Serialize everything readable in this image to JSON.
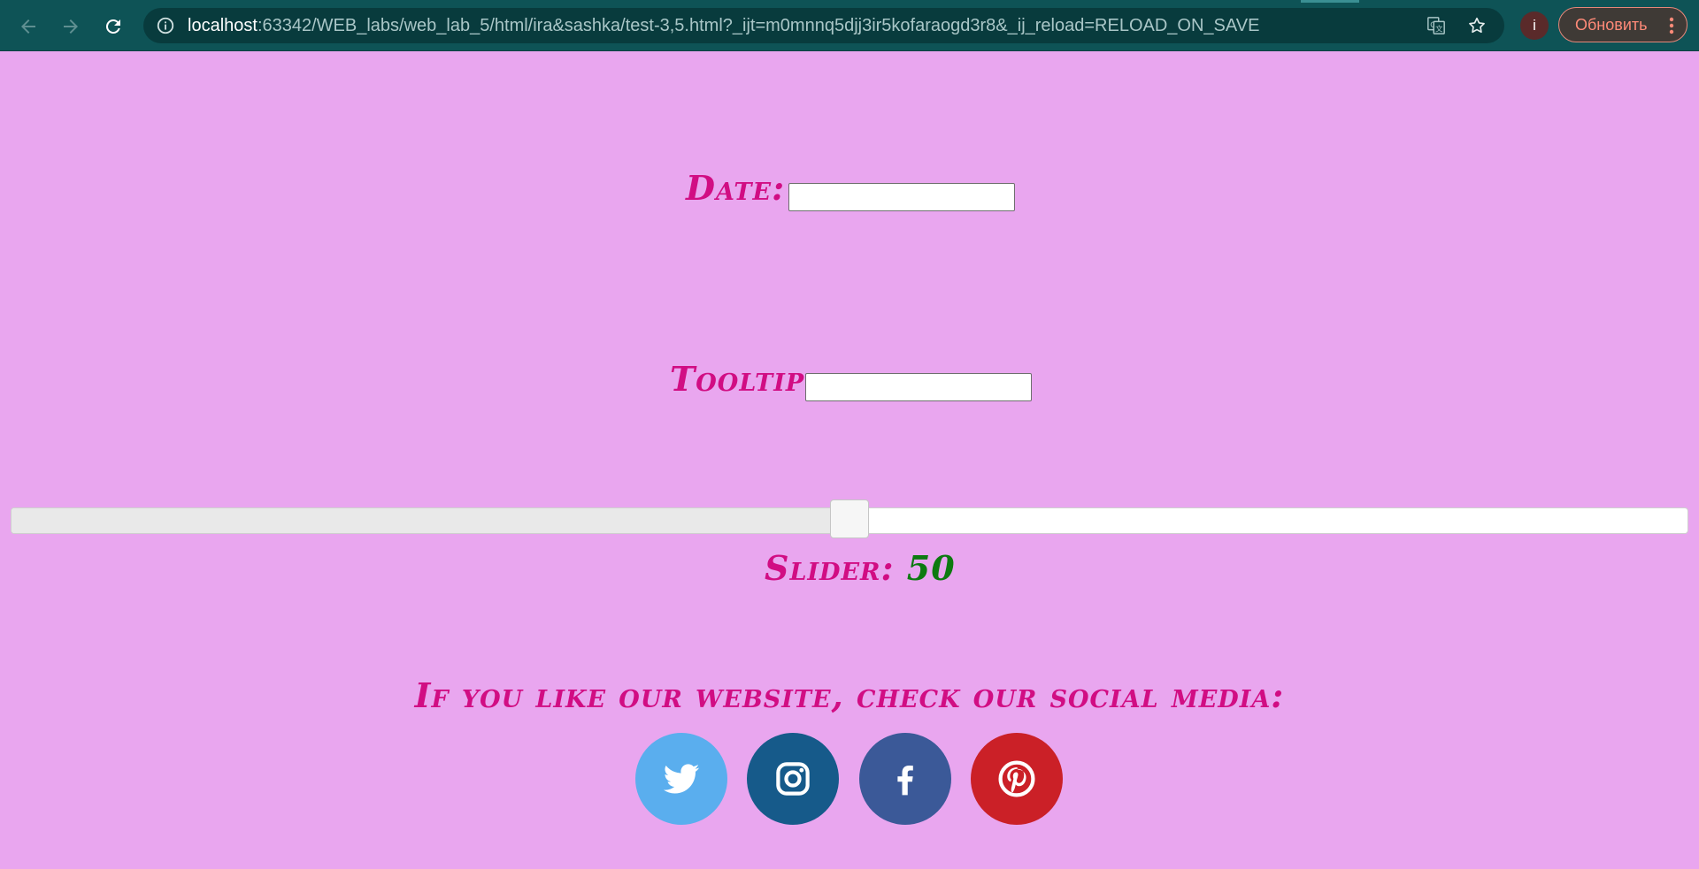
{
  "browser": {
    "url_host": "localhost",
    "url_rest": ":63342/WEB_labs/web_lab_5/html/ira&sashka/test-3,5.html?_ijt=m0mnnq5djj3ir5kofaraogd3r8&_ij_reload=RELOAD_ON_SAVE",
    "profile_initial": "i",
    "update_label": "Обновить",
    "icons": [
      "back-arrow-icon",
      "forward-arrow-icon",
      "reload-icon",
      "info-icon",
      "translate-icon",
      "star-icon",
      "more-vert-icon"
    ]
  },
  "form": {
    "date_label": "Date:",
    "date_value": "",
    "tooltip_label": "Tooltip:",
    "tooltip_value": ""
  },
  "slider": {
    "label": "Slider:",
    "value": 50,
    "value_text": "50",
    "min": 0,
    "max": 100
  },
  "social": {
    "heading": "If you like our website, check our social media:",
    "links": [
      {
        "name": "twitter",
        "color": "#5aaeee"
      },
      {
        "name": "instagram",
        "color": "#165a8a"
      },
      {
        "name": "facebook",
        "color": "#3b5998"
      },
      {
        "name": "pinterest",
        "color": "#cb2027"
      }
    ]
  },
  "colors": {
    "page_background": "#e9a6ef",
    "label_text": "#d10d83",
    "slider_value_text": "#0d7a10",
    "browser_toolbar": "#0e5356"
  }
}
